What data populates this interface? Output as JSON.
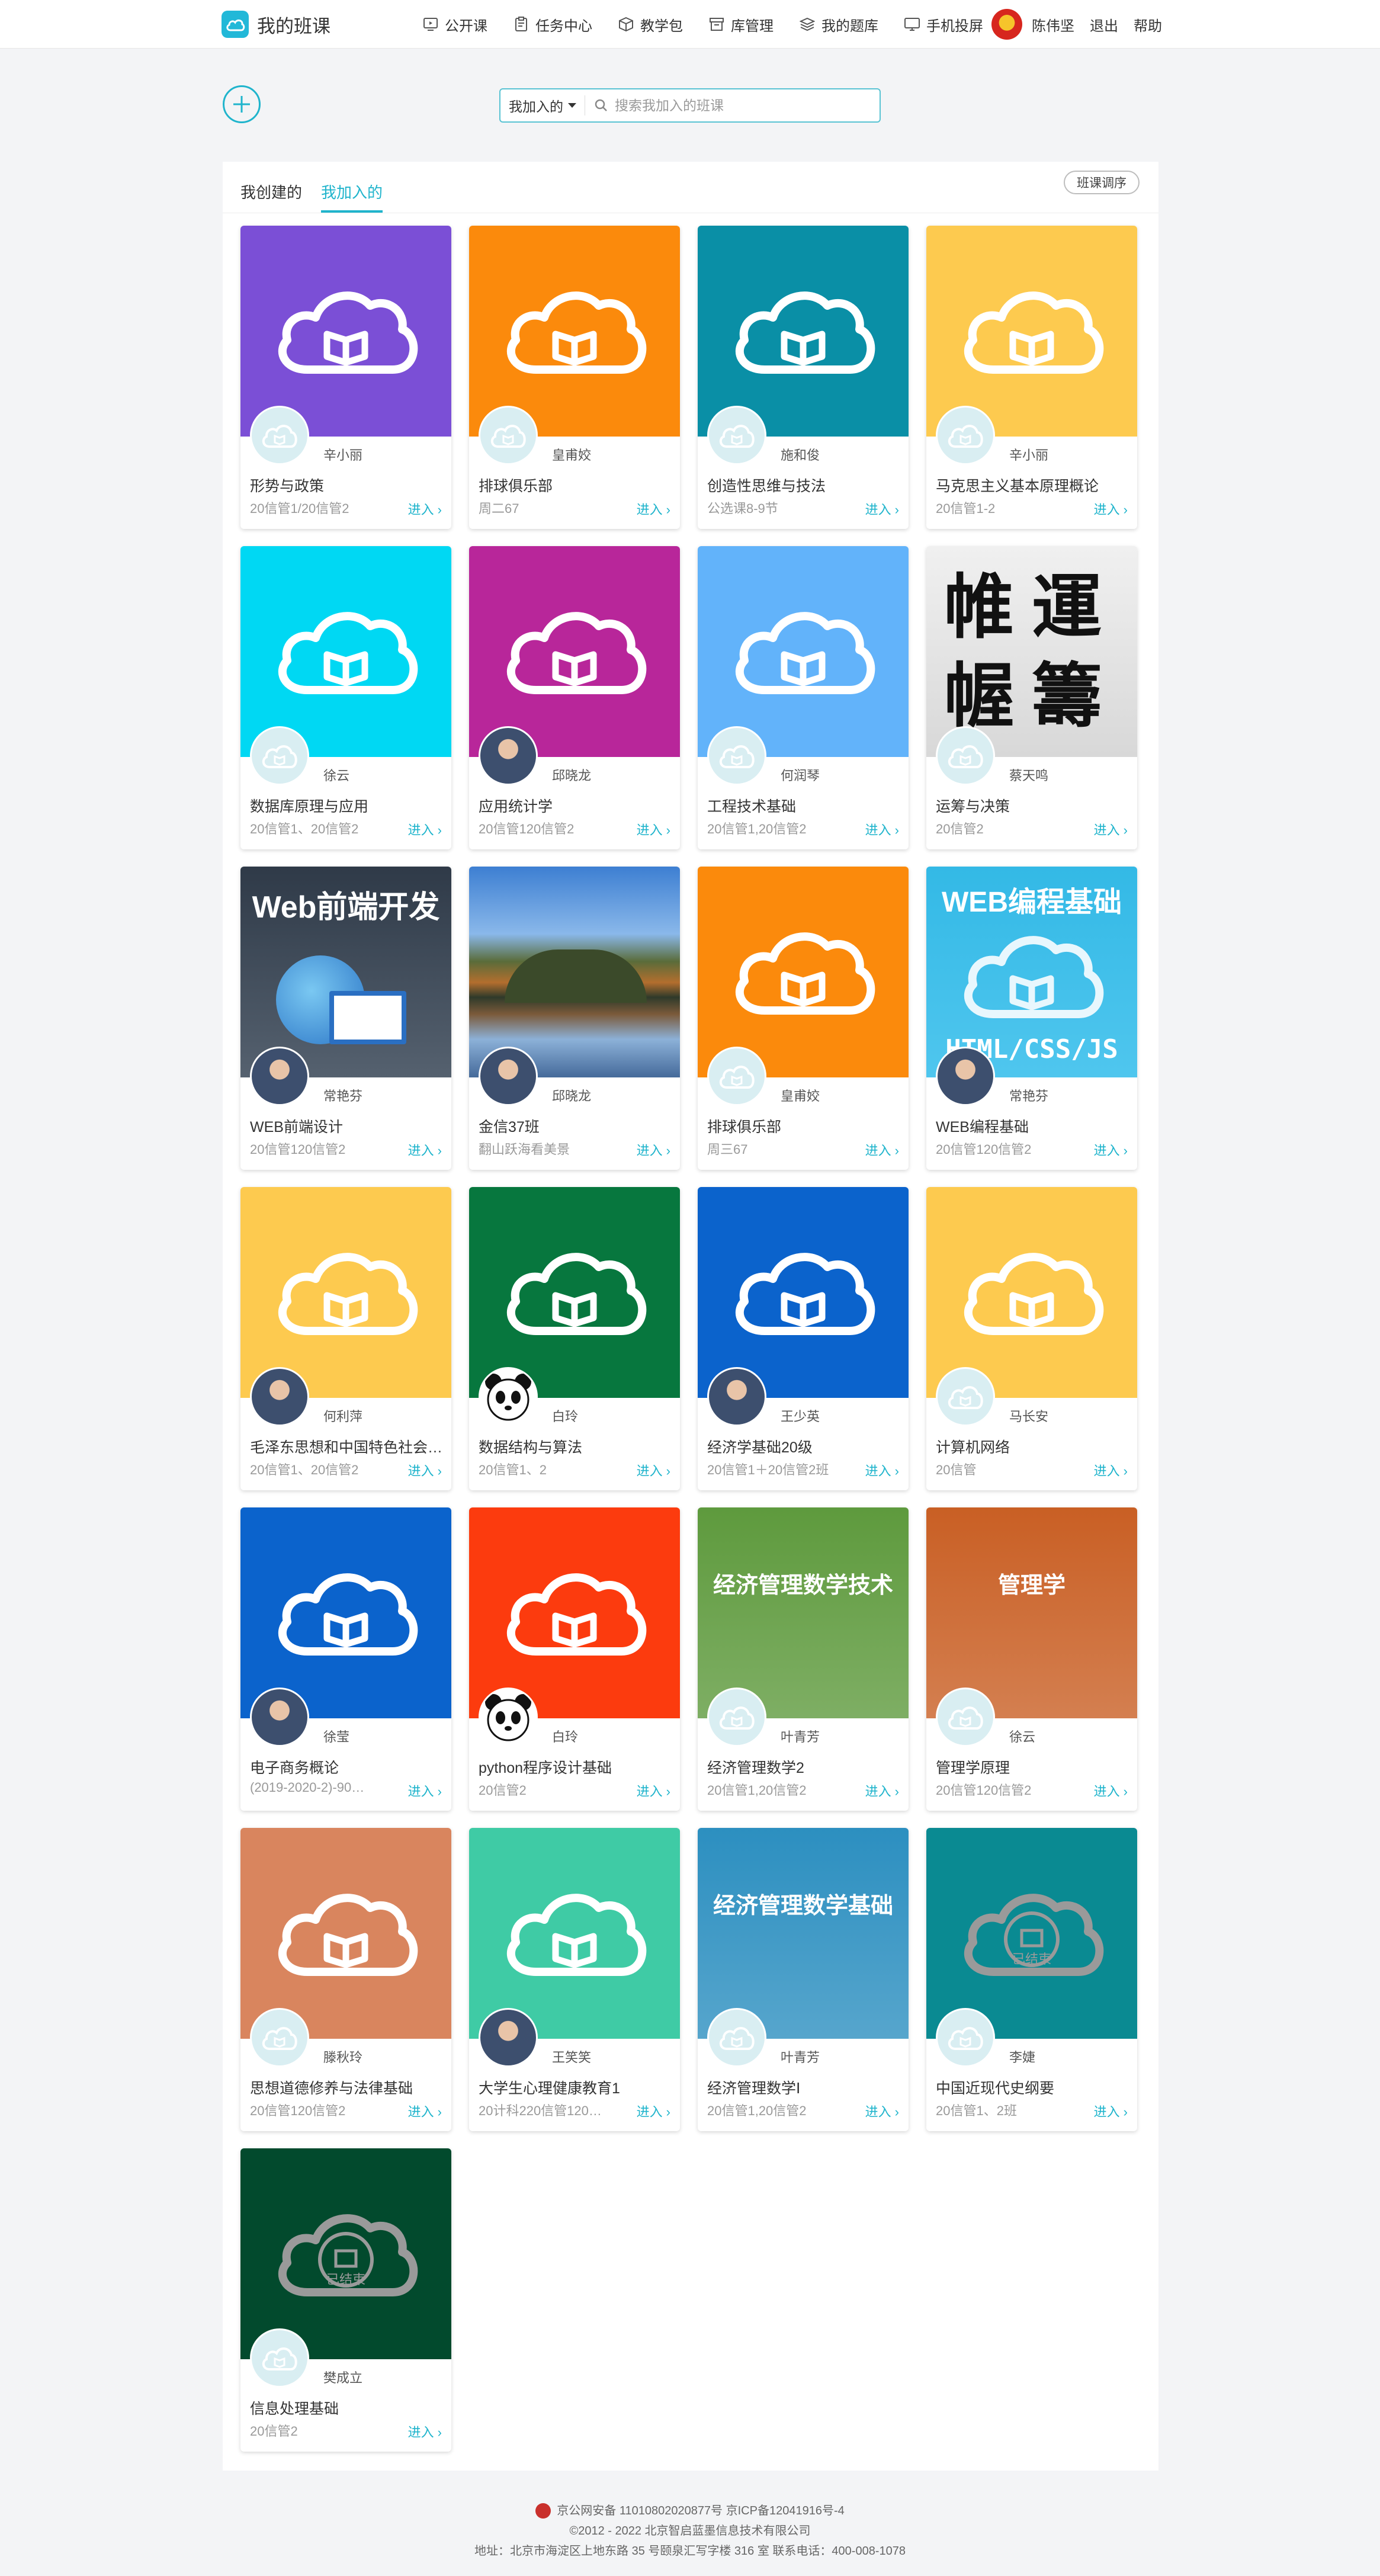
{
  "header": {
    "title": "我的班课",
    "nav": [
      {
        "label": "公开课",
        "icon": "public-course-icon"
      },
      {
        "label": "任务中心",
        "icon": "task-icon"
      },
      {
        "label": "教学包",
        "icon": "package-icon"
      },
      {
        "label": "库管理",
        "icon": "library-icon"
      },
      {
        "label": "我的题库",
        "icon": "question-bank-icon"
      },
      {
        "label": "手机投屏",
        "icon": "screen-cast-icon"
      }
    ],
    "user_name": "陈伟坚",
    "logout": "退出",
    "help": "帮助"
  },
  "search": {
    "filter": "我加入的",
    "placeholder": "搜索我加入的班课"
  },
  "tabs": [
    {
      "label": "我创建的",
      "active": false
    },
    {
      "label": "我加入的",
      "active": true
    }
  ],
  "sort_button": "班课调序",
  "enter_label": "进入",
  "courses": [
    {
      "teacher": "辛小丽",
      "course": "形势与政策",
      "classes": "20信管1/20信管2",
      "color": "#7b4fd6",
      "cover": "cloud"
    },
    {
      "teacher": "皇甫姣",
      "course": "排球俱乐部",
      "classes": "周二67",
      "color": "#fb8a0c",
      "cover": "cloud"
    },
    {
      "teacher": "施和俊",
      "course": "创造性思维与技法",
      "classes": "公选课8-9节",
      "color": "#0a8fa6",
      "cover": "cloud"
    },
    {
      "teacher": "辛小丽",
      "course": "马克思主义基本原理概论",
      "classes": "20信管1-2",
      "color": "#fdca4f",
      "cover": "cloud"
    },
    {
      "teacher": "徐云",
      "course": "数据库原理与应用",
      "classes": "20信管1、20信管2",
      "color": "#00d8f3",
      "cover": "cloud"
    },
    {
      "teacher": "邱晓龙",
      "course": "应用统计学",
      "classes": "20信管120信管2",
      "color": "#b8269a",
      "cover": "cloud",
      "avatar": "photo"
    },
    {
      "teacher": "何润琴",
      "course": "工程技术基础",
      "classes": "20信管1,20信管2",
      "color": "#62b3fa",
      "cover": "cloud"
    },
    {
      "teacher": "蔡天鸣",
      "course": "运筹与决策",
      "classes": "20信管2",
      "color": "#e3e3e3",
      "cover": "calligraphy",
      "cover_text": "帷運幄籌"
    },
    {
      "teacher": "常艳芬",
      "course": "WEB前端设计",
      "classes": "20信管120信管2",
      "color": "#3b4757",
      "cover": "web",
      "cover_text": "Web前端开发",
      "avatar": "photo"
    },
    {
      "teacher": "邱晓龙",
      "course": "金信37班",
      "classes": "翻山跃海看美景",
      "color": "#3f7cd0",
      "cover": "landscape",
      "avatar": "photo"
    },
    {
      "teacher": "皇甫姣",
      "course": "排球俱乐部",
      "classes": "周三67",
      "color": "#fb8a0c",
      "cover": "cloud"
    },
    {
      "teacher": "常艳芬",
      "course": "WEB编程基础",
      "classes": "20信管120信管2",
      "color": "#3cc0ea",
      "cover": "webprog",
      "cover_text": "WEB编程基础",
      "cover_text2": "HTML/CSS/JS",
      "avatar": "photo"
    },
    {
      "teacher": "何利萍",
      "course": "毛泽东思想和中国特色社会主义理论体系概论",
      "classes": "20信管1、20信管2",
      "color": "#fdca4f",
      "cover": "cloud",
      "avatar": "photo"
    },
    {
      "teacher": "白玲",
      "course": "数据结构与算法",
      "classes": "20信管1、2",
      "color": "#07773e",
      "cover": "cloud",
      "avatar": "panda"
    },
    {
      "teacher": "王少英",
      "course": "经济学基础20级",
      "classes": "20信管1＋20信管2班",
      "color": "#0b63cc",
      "cover": "cloud",
      "avatar": "photo"
    },
    {
      "teacher": "马长安",
      "course": "计算机网络",
      "classes": "20信管",
      "color": "#fdca4f",
      "cover": "cloud"
    },
    {
      "teacher": "徐莹",
      "course": "电子商务概论",
      "classes": "(2019-2020-2)-90…",
      "color": "#0b63cc",
      "cover": "cloud",
      "avatar": "photo"
    },
    {
      "teacher": "白玲",
      "course": "python程序设计基础",
      "classes": "20信管2",
      "color": "#fc3b0e",
      "cover": "cloud",
      "avatar": "panda"
    },
    {
      "teacher": "叶青芳",
      "course": "经济管理数学2",
      "classes": "20信管1,20信管2",
      "color": "#5e9a3d",
      "cover": "book",
      "cover_text": "经济管理数学技术"
    },
    {
      "teacher": "徐云",
      "course": "管理学原理",
      "classes": "20信管120信管2",
      "color": "#c95f24",
      "cover": "book",
      "cover_text": "管理学"
    },
    {
      "teacher": "滕秋玲",
      "course": "思想道德修养与法律基础",
      "classes": "20信管120信管2",
      "color": "#d9855e",
      "cover": "cloud"
    },
    {
      "teacher": "王笑笑",
      "course": "大学生心理健康教育1",
      "classes": "20计科220信管120…",
      "color": "#3fcba5",
      "cover": "cloud",
      "avatar": "photo"
    },
    {
      "teacher": "叶青芳",
      "course": "经济管理数学Ⅰ",
      "classes": "20信管1,20信管2",
      "color": "#2c8fc0",
      "cover": "book",
      "cover_text": "经济管理数学基础"
    },
    {
      "teacher": "李婕",
      "course": "中国近现代史纲要",
      "classes": "20信管1、2班",
      "color": "#0a8a92",
      "cover": "finished",
      "cover_text": "已结束"
    },
    {
      "teacher": "樊成立",
      "course": "信息处理基础",
      "classes": "20信管2",
      "color": "#024a2d",
      "cover": "finished",
      "cover_text": "已结束"
    }
  ],
  "footer": {
    "line1": "京公网安备 11010802020877号   京ICP备12041916号-4",
    "line2": "©2012 - 2022 北京智启蓝墨信息技术有限公司",
    "line3": "地址：北京市海淀区上地东路 35 号颐泉汇写字楼 316 室     联系电话：400-008-1078"
  }
}
